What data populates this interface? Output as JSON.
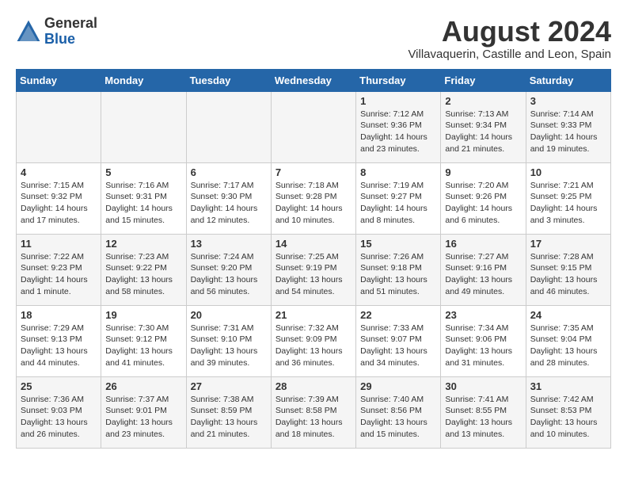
{
  "logo": {
    "general": "General",
    "blue": "Blue"
  },
  "title": {
    "month_year": "August 2024",
    "location": "Villavaquerin, Castille and Leon, Spain"
  },
  "days_of_week": [
    "Sunday",
    "Monday",
    "Tuesday",
    "Wednesday",
    "Thursday",
    "Friday",
    "Saturday"
  ],
  "weeks": [
    [
      {
        "day": "",
        "info": ""
      },
      {
        "day": "",
        "info": ""
      },
      {
        "day": "",
        "info": ""
      },
      {
        "day": "",
        "info": ""
      },
      {
        "day": "1",
        "info": "Sunrise: 7:12 AM\nSunset: 9:36 PM\nDaylight: 14 hours and 23 minutes."
      },
      {
        "day": "2",
        "info": "Sunrise: 7:13 AM\nSunset: 9:34 PM\nDaylight: 14 hours and 21 minutes."
      },
      {
        "day": "3",
        "info": "Sunrise: 7:14 AM\nSunset: 9:33 PM\nDaylight: 14 hours and 19 minutes."
      }
    ],
    [
      {
        "day": "4",
        "info": "Sunrise: 7:15 AM\nSunset: 9:32 PM\nDaylight: 14 hours and 17 minutes."
      },
      {
        "day": "5",
        "info": "Sunrise: 7:16 AM\nSunset: 9:31 PM\nDaylight: 14 hours and 15 minutes."
      },
      {
        "day": "6",
        "info": "Sunrise: 7:17 AM\nSunset: 9:30 PM\nDaylight: 14 hours and 12 minutes."
      },
      {
        "day": "7",
        "info": "Sunrise: 7:18 AM\nSunset: 9:28 PM\nDaylight: 14 hours and 10 minutes."
      },
      {
        "day": "8",
        "info": "Sunrise: 7:19 AM\nSunset: 9:27 PM\nDaylight: 14 hours and 8 minutes."
      },
      {
        "day": "9",
        "info": "Sunrise: 7:20 AM\nSunset: 9:26 PM\nDaylight: 14 hours and 6 minutes."
      },
      {
        "day": "10",
        "info": "Sunrise: 7:21 AM\nSunset: 9:25 PM\nDaylight: 14 hours and 3 minutes."
      }
    ],
    [
      {
        "day": "11",
        "info": "Sunrise: 7:22 AM\nSunset: 9:23 PM\nDaylight: 14 hours and 1 minute."
      },
      {
        "day": "12",
        "info": "Sunrise: 7:23 AM\nSunset: 9:22 PM\nDaylight: 13 hours and 58 minutes."
      },
      {
        "day": "13",
        "info": "Sunrise: 7:24 AM\nSunset: 9:20 PM\nDaylight: 13 hours and 56 minutes."
      },
      {
        "day": "14",
        "info": "Sunrise: 7:25 AM\nSunset: 9:19 PM\nDaylight: 13 hours and 54 minutes."
      },
      {
        "day": "15",
        "info": "Sunrise: 7:26 AM\nSunset: 9:18 PM\nDaylight: 13 hours and 51 minutes."
      },
      {
        "day": "16",
        "info": "Sunrise: 7:27 AM\nSunset: 9:16 PM\nDaylight: 13 hours and 49 minutes."
      },
      {
        "day": "17",
        "info": "Sunrise: 7:28 AM\nSunset: 9:15 PM\nDaylight: 13 hours and 46 minutes."
      }
    ],
    [
      {
        "day": "18",
        "info": "Sunrise: 7:29 AM\nSunset: 9:13 PM\nDaylight: 13 hours and 44 minutes."
      },
      {
        "day": "19",
        "info": "Sunrise: 7:30 AM\nSunset: 9:12 PM\nDaylight: 13 hours and 41 minutes."
      },
      {
        "day": "20",
        "info": "Sunrise: 7:31 AM\nSunset: 9:10 PM\nDaylight: 13 hours and 39 minutes."
      },
      {
        "day": "21",
        "info": "Sunrise: 7:32 AM\nSunset: 9:09 PM\nDaylight: 13 hours and 36 minutes."
      },
      {
        "day": "22",
        "info": "Sunrise: 7:33 AM\nSunset: 9:07 PM\nDaylight: 13 hours and 34 minutes."
      },
      {
        "day": "23",
        "info": "Sunrise: 7:34 AM\nSunset: 9:06 PM\nDaylight: 13 hours and 31 minutes."
      },
      {
        "day": "24",
        "info": "Sunrise: 7:35 AM\nSunset: 9:04 PM\nDaylight: 13 hours and 28 minutes."
      }
    ],
    [
      {
        "day": "25",
        "info": "Sunrise: 7:36 AM\nSunset: 9:03 PM\nDaylight: 13 hours and 26 minutes."
      },
      {
        "day": "26",
        "info": "Sunrise: 7:37 AM\nSunset: 9:01 PM\nDaylight: 13 hours and 23 minutes."
      },
      {
        "day": "27",
        "info": "Sunrise: 7:38 AM\nSunset: 8:59 PM\nDaylight: 13 hours and 21 minutes."
      },
      {
        "day": "28",
        "info": "Sunrise: 7:39 AM\nSunset: 8:58 PM\nDaylight: 13 hours and 18 minutes."
      },
      {
        "day": "29",
        "info": "Sunrise: 7:40 AM\nSunset: 8:56 PM\nDaylight: 13 hours and 15 minutes."
      },
      {
        "day": "30",
        "info": "Sunrise: 7:41 AM\nSunset: 8:55 PM\nDaylight: 13 hours and 13 minutes."
      },
      {
        "day": "31",
        "info": "Sunrise: 7:42 AM\nSunset: 8:53 PM\nDaylight: 13 hours and 10 minutes."
      }
    ]
  ]
}
